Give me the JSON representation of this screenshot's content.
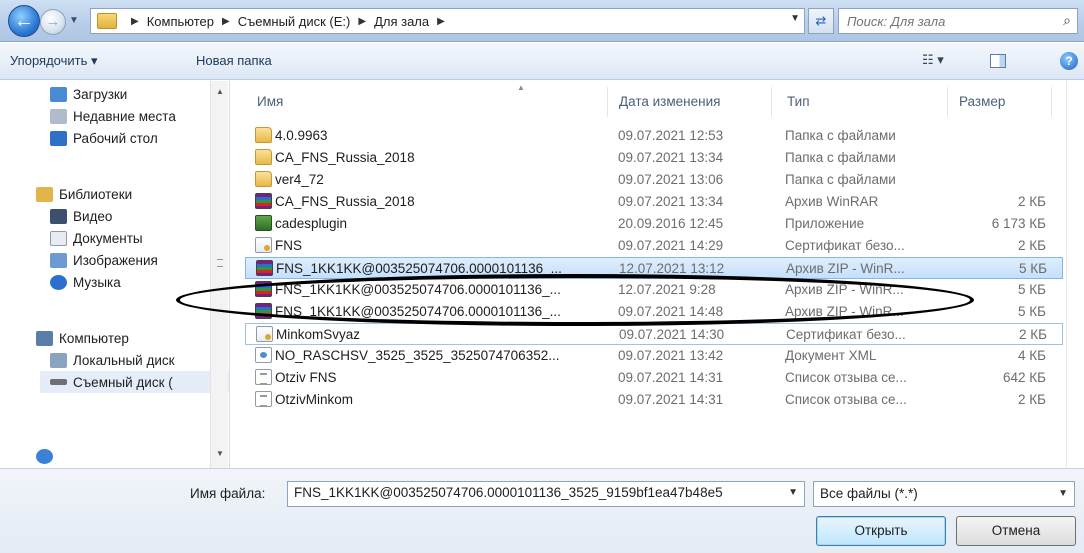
{
  "address": {
    "crumbs": [
      "Компьютер",
      "Съемный диск (E:)",
      "Для зала"
    ],
    "search_placeholder": "Поиск: Для зала"
  },
  "toolbar": {
    "organize_label": "Упорядочить ▾",
    "new_folder_label": "Новая папка",
    "views_label": "☷ ▾",
    "help_label": "?"
  },
  "sidebar": {
    "items": [
      {
        "label": "Загрузки",
        "icon": "downloads-icon",
        "color": "#4a8bd8"
      },
      {
        "label": "Недавние места",
        "icon": "recent-places-icon",
        "color": "#b0bccb"
      },
      {
        "label": "Рабочий стол",
        "icon": "desktop-icon",
        "color": "#2f70c9"
      },
      {
        "label": "Библиотеки",
        "icon": "libraries-icon",
        "color": "#e2b54a"
      },
      {
        "label": "Видео",
        "icon": "video-icon",
        "color": "#3d4f6c"
      },
      {
        "label": "Документы",
        "icon": "documents-icon",
        "color": "#e8edf3"
      },
      {
        "label": "Изображения",
        "icon": "pictures-icon",
        "color": "#6c9ad1"
      },
      {
        "label": "Музыка",
        "icon": "music-icon",
        "color": "#2d6fd0"
      },
      {
        "label": "Компьютер",
        "icon": "computer-icon",
        "color": "#5a7ea8"
      },
      {
        "label": "Локальный диск",
        "icon": "local-disk-icon",
        "color": "#8aa3bf"
      },
      {
        "label": "Съемный диск (",
        "icon": "removable-disk-icon",
        "color": "#6f6f6f"
      }
    ]
  },
  "columns": {
    "name": "Имя",
    "date": "Дата изменения",
    "type": "Тип",
    "size": "Размер"
  },
  "files": [
    {
      "name": "4.0.9963",
      "date": "09.07.2021 12:53",
      "type": "Папка с файлами",
      "size": "",
      "icon": "folder-icon"
    },
    {
      "name": "CA_FNS_Russia_2018",
      "date": "09.07.2021 13:34",
      "type": "Папка с файлами",
      "size": "",
      "icon": "folder-icon"
    },
    {
      "name": "ver4_72",
      "date": "09.07.2021 13:06",
      "type": "Папка с файлами",
      "size": "",
      "icon": "folder-icon"
    },
    {
      "name": "CA_FNS_Russia_2018",
      "date": "09.07.2021 13:34",
      "type": "Архив WinRAR",
      "size": "2 КБ",
      "icon": "winrar-icon"
    },
    {
      "name": "cadesplugin",
      "date": "20.09.2016 12:45",
      "type": "Приложение",
      "size": "6 173 КБ",
      "icon": "application-icon"
    },
    {
      "name": "FNS",
      "date": "09.07.2021 14:29",
      "type": "Сертификат безо...",
      "size": "2 КБ",
      "icon": "certificate-icon"
    },
    {
      "name": "FNS_1KK1KK@003525074706.0000101136_...",
      "date": "12.07.2021 13:12",
      "type": "Архив ZIP - WinR...",
      "size": "5 КБ",
      "icon": "winrar-icon"
    },
    {
      "name": "FNS_1KK1KK@003525074706.0000101136_...",
      "date": "12.07.2021 9:28",
      "type": "Архив ZIP - WinR...",
      "size": "5 КБ",
      "icon": "winrar-icon"
    },
    {
      "name": "FNS_1KK1KK@003525074706.0000101136_...",
      "date": "09.07.2021 14:48",
      "type": "Архив ZIP - WinR...",
      "size": "5 КБ",
      "icon": "winrar-icon"
    },
    {
      "name": "MinkomSvyaz",
      "date": "09.07.2021 14:30",
      "type": "Сертификат безо...",
      "size": "2 КБ",
      "icon": "certificate-icon"
    },
    {
      "name": "NO_RASCHSV_3525_3525_3525074706352...",
      "date": "09.07.2021 13:42",
      "type": "Документ XML",
      "size": "4 КБ",
      "icon": "xml-icon"
    },
    {
      "name": "Otziv FNS",
      "date": "09.07.2021 14:31",
      "type": "Список отзыва се...",
      "size": "642 КБ",
      "icon": "crl-icon"
    },
    {
      "name": "OtzivMinkom",
      "date": "09.07.2021 14:31",
      "type": "Список отзыва се...",
      "size": "2 КБ",
      "icon": "crl-icon"
    }
  ],
  "selected_index": 6,
  "bottom": {
    "filename_label": "Имя файла:",
    "filename_value": "FNS_1KK1KK@003525074706.0000101136_3525_9159bf1ea47b48e5",
    "filter_value": "Все файлы (*.*)",
    "open_label": "Открыть",
    "cancel_label": "Отмена"
  }
}
